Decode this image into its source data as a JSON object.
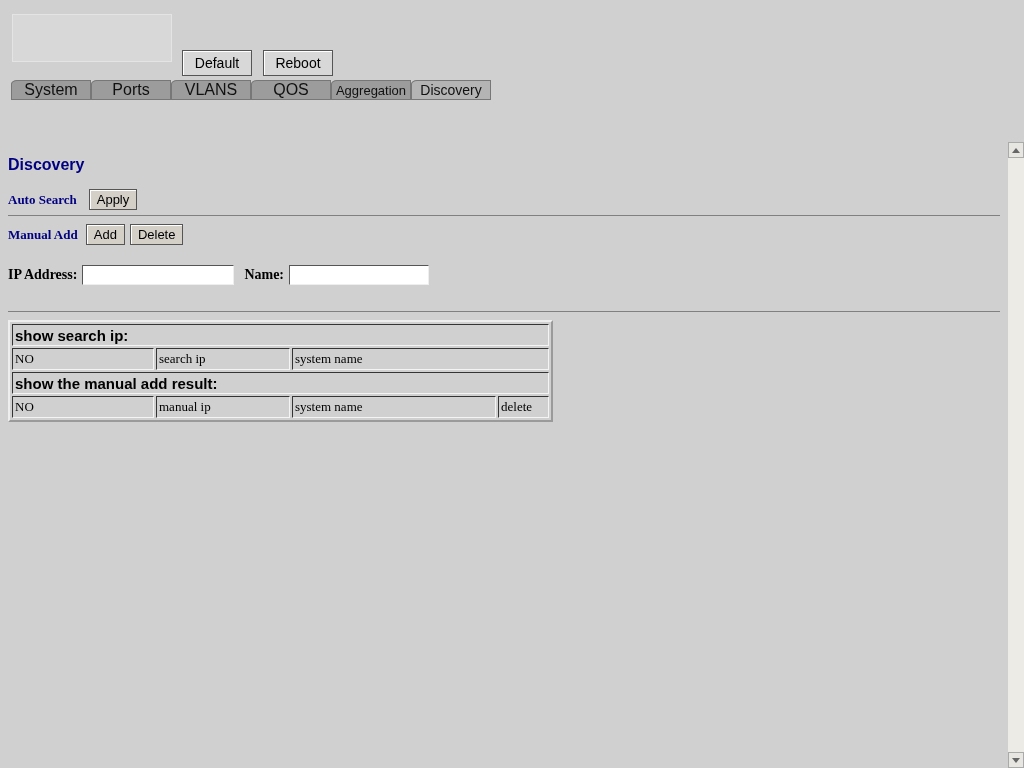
{
  "header_buttons": [
    "Default",
    "Reboot"
  ],
  "tabs": [
    {
      "label": "System",
      "selected": false
    },
    {
      "label": "Ports",
      "selected": false
    },
    {
      "label": "VLANS",
      "selected": false
    },
    {
      "label": "QOS",
      "selected": false
    },
    {
      "label": "Aggregation",
      "selected": false,
      "small": true
    },
    {
      "label": "Discovery",
      "selected": true
    }
  ],
  "page_title": "Discovery",
  "auto_search": {
    "label": "Auto Search",
    "button": "Apply"
  },
  "manual_add": {
    "label": "Manual Add",
    "buttons": [
      "Add",
      "Delete"
    ]
  },
  "form": {
    "ip_label": "IP Address:",
    "name_label": "Name:"
  },
  "search_table": {
    "title": "show search ip:",
    "columns": [
      "NO",
      "search ip",
      "system name"
    ]
  },
  "manual_table": {
    "title": "show the manual add result:",
    "columns": [
      "NO",
      "manual ip",
      "system name",
      "delete"
    ]
  }
}
